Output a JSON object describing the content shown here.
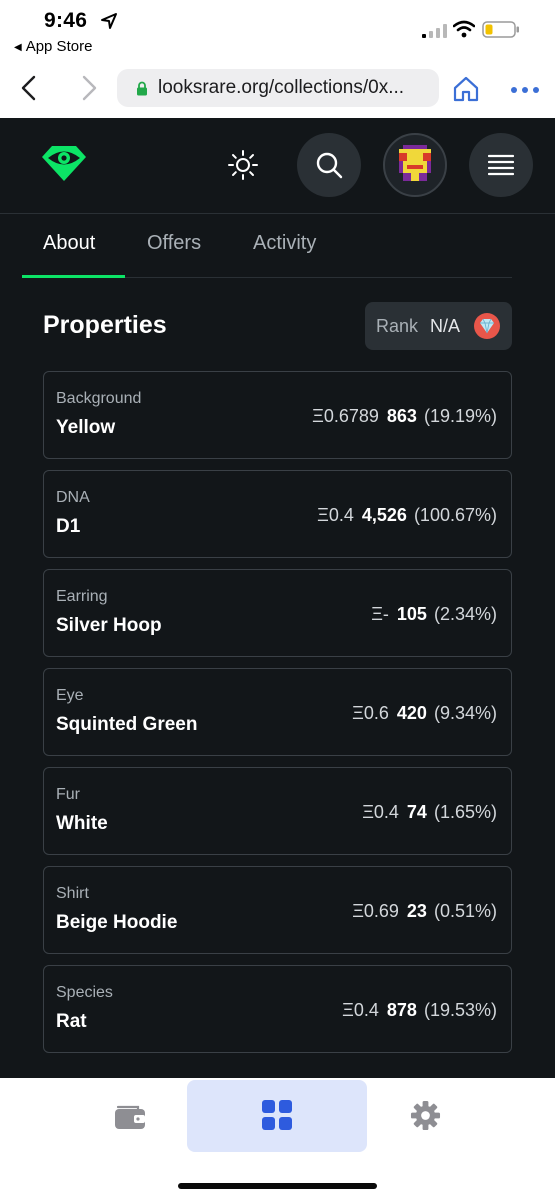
{
  "status_bar": {
    "time": "9:46",
    "back_app": "App Store"
  },
  "browser": {
    "url": "looksrare.org/collections/0x..."
  },
  "tabs": [
    {
      "label": "About",
      "active": true
    },
    {
      "label": "Offers",
      "active": false
    },
    {
      "label": "Activity",
      "active": false
    }
  ],
  "properties": {
    "title": "Properties",
    "rank_label": "Rank",
    "rank_value": "N/A",
    "items": [
      {
        "type": "Background",
        "value": "Yellow",
        "price": "Ξ0.6789",
        "count": "863",
        "percent": "(19.19%)"
      },
      {
        "type": "DNA",
        "value": "D1",
        "price": "Ξ0.4",
        "count": "4,526",
        "percent": "(100.67%)"
      },
      {
        "type": "Earring",
        "value": "Silver Hoop",
        "price": "Ξ-",
        "count": "105",
        "percent": "(2.34%)"
      },
      {
        "type": "Eye",
        "value": "Squinted Green",
        "price": "Ξ0.6",
        "count": "420",
        "percent": "(9.34%)"
      },
      {
        "type": "Fur",
        "value": "White",
        "price": "Ξ0.4",
        "count": "74",
        "percent": "(1.65%)"
      },
      {
        "type": "Shirt",
        "value": "Beige Hoodie",
        "price": "Ξ0.69",
        "count": "23",
        "percent": "(0.51%)"
      },
      {
        "type": "Species",
        "value": "Rat",
        "price": "Ξ0.4",
        "count": "878",
        "percent": "(19.53%)"
      }
    ]
  },
  "colors": {
    "accent_green": "#0ce466",
    "background": "#121619",
    "bottom_tab_active": "#2e5bde"
  },
  "icons": {
    "logo": "looksrare-eye-logo",
    "theme": "sun-icon",
    "search": "search-icon",
    "menu": "hamburger-menu-icon",
    "wallet": "wallet-icon",
    "grid": "grid-icon",
    "settings": "gear-icon"
  }
}
